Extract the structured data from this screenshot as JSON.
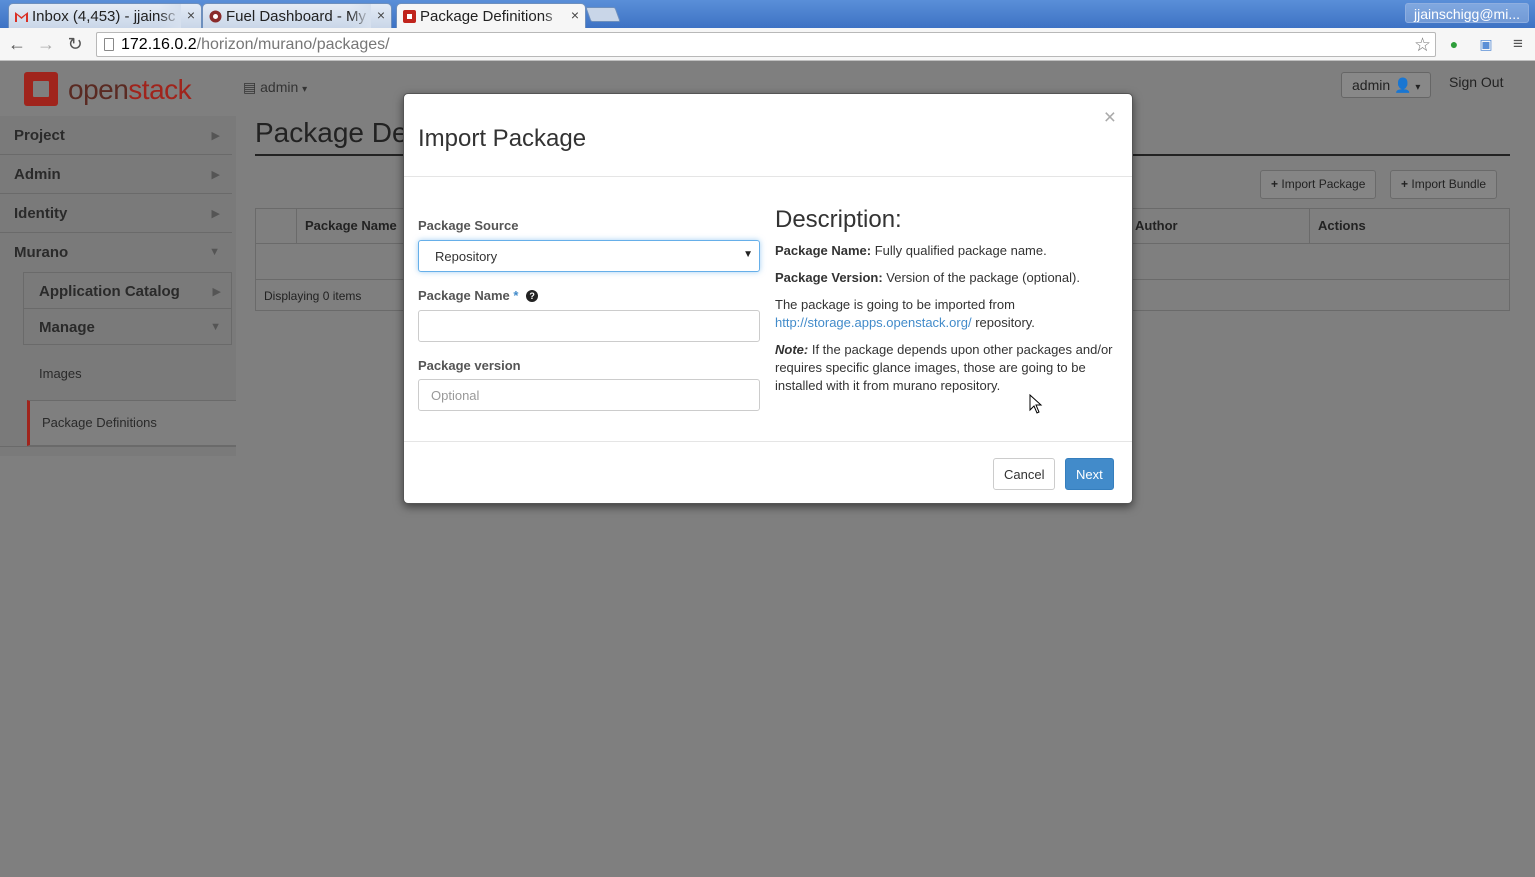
{
  "browser": {
    "tabs": [
      {
        "title": "Inbox (4,453) - jjainsc",
        "icon": "gmail-icon"
      },
      {
        "title": "Fuel Dashboard - My",
        "icon": "fuel-icon"
      },
      {
        "title": "Package Definitions",
        "icon": "openstack-icon"
      }
    ],
    "profile": "jjainschigg@mi...",
    "url_host": "172.16.0.2",
    "url_path": "/horizon/murano/packages/"
  },
  "header": {
    "logo_a": "open",
    "logo_b": "stack",
    "project_dropdown": "admin",
    "user_dropdown": "admin",
    "sign_out": "Sign Out"
  },
  "sidebar": {
    "items": [
      {
        "label": "Project"
      },
      {
        "label": "Admin"
      },
      {
        "label": "Identity"
      },
      {
        "label": "Murano"
      }
    ],
    "murano_sub": [
      {
        "label": "Application Catalog"
      },
      {
        "label": "Manage"
      }
    ],
    "manage_leaves": [
      {
        "label": "Images"
      },
      {
        "label": "Package Definitions"
      }
    ]
  },
  "content": {
    "title": "Package Def",
    "import_package_btn": "Import Package",
    "import_bundle_btn": "Import Bundle",
    "columns": [
      "Package Name",
      "Author",
      "Actions"
    ],
    "footer": "Displaying 0 items"
  },
  "modal": {
    "title": "Import Package",
    "close": "×",
    "source_label": "Package Source",
    "source_value": "Repository",
    "name_label": "Package Name",
    "required_mark": "*",
    "version_label": "Package version",
    "version_placeholder": "Optional",
    "desc_heading": "Description:",
    "desc_name_bold": "Package Name:",
    "desc_name_text": " Fully qualified package name.",
    "desc_version_bold": "Package Version:",
    "desc_version_text": " Version of the package (optional).",
    "desc_repo_pre": "The package is going to be imported from",
    "desc_repo_link": "http://storage.apps.openstack.org/",
    "desc_repo_post": " repository.",
    "desc_note_bold": "Note:",
    "desc_note_text": " If the package depends upon other packages and/or requires specific glance images, those are going to be installed with it from murano repository.",
    "cancel": "Cancel",
    "next": "Next"
  }
}
